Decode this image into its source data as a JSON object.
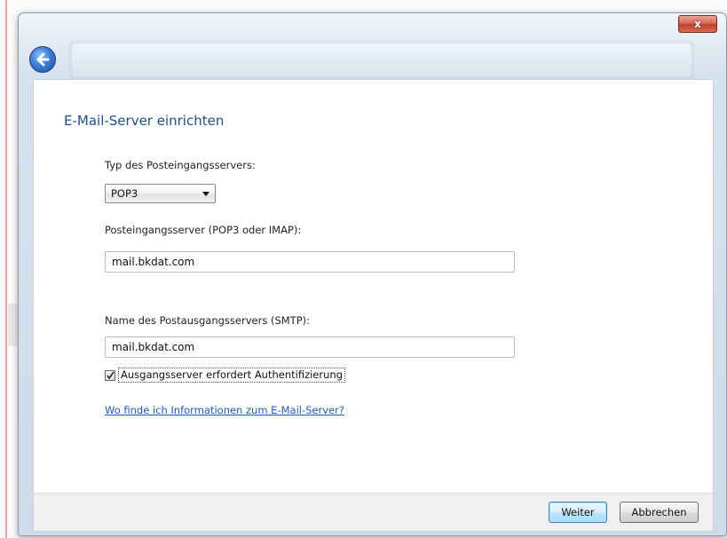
{
  "window": {
    "close_glyph": "x",
    "back_icon": "back-arrow-icon",
    "accent_color": "#1e4f97",
    "link_color": "#1a5dc7"
  },
  "address_bar": {
    "ghost_text": "",
    "ghost_arrows": ""
  },
  "main": {
    "heading": "E-Mail-Server einrichten",
    "incoming_type_label": "Typ des Posteingangsservers:",
    "incoming_type_value": "POP3",
    "incoming_server_label": "Posteingangsserver (POP3 oder IMAP):",
    "incoming_server_value": "mail.bkdat.com",
    "outgoing_server_label": "Name des Postausgangsservers (SMTP):",
    "outgoing_server_value": "mail.bkdat.com",
    "auth_checkbox_label": "Ausgangsserver erfordert Authentifizierung",
    "auth_checked": true,
    "help_link": "Wo finde ich Informationen zum E-Mail-Server?"
  },
  "footer": {
    "next_label": "Weiter",
    "cancel_label": "Abbrechen"
  }
}
